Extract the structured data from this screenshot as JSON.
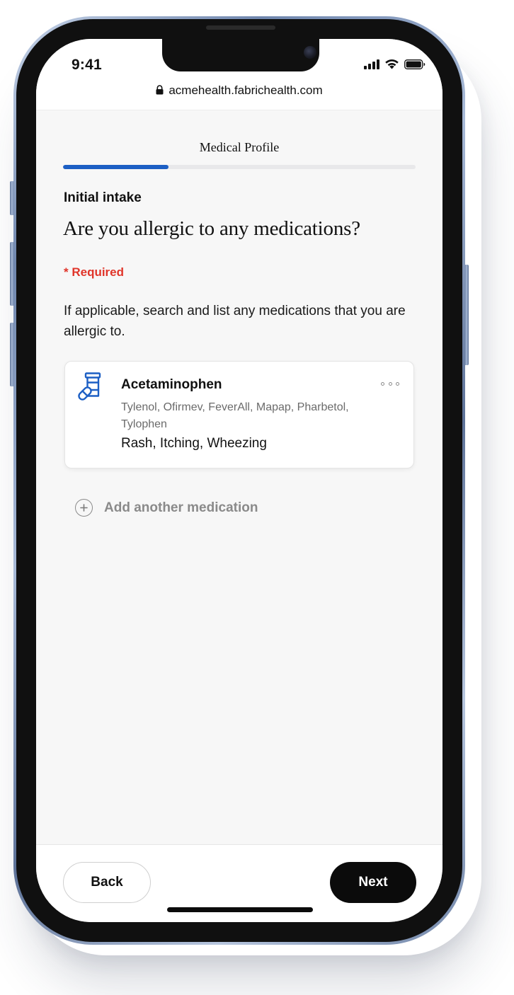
{
  "status_bar": {
    "time": "9:41",
    "icons": [
      "signal-icon",
      "wifi-icon",
      "battery-icon"
    ]
  },
  "browser": {
    "url": "acmehealth.fabrichealth.com",
    "lock_icon": "lock-icon"
  },
  "page": {
    "section_title": "Medical Profile",
    "progress_fraction": 0.3,
    "step_label": "Initial intake",
    "question": "Are you allergic to any medications?",
    "required_label": "* Required",
    "helper_text": "If applicable, search and list any medications that you are allergic to."
  },
  "medications": [
    {
      "icon": "pill-bottle-icon",
      "name": "Acetaminophen",
      "aliases": "Tylenol, Ofirmev, FeverAll, Mapap, Pharbetol, Tylophen",
      "reactions": "Rash, Itching, Wheezing",
      "more_icon": "more-options-icon"
    }
  ],
  "add_medication": {
    "icon": "plus-circle-icon",
    "label": "Add another medication"
  },
  "footer": {
    "back_label": "Back",
    "next_label": "Next"
  },
  "colors": {
    "accent": "#1c5fc4",
    "required": "#e0352a",
    "primary_button": "#0b0b0b",
    "frame": "#7085a8"
  }
}
